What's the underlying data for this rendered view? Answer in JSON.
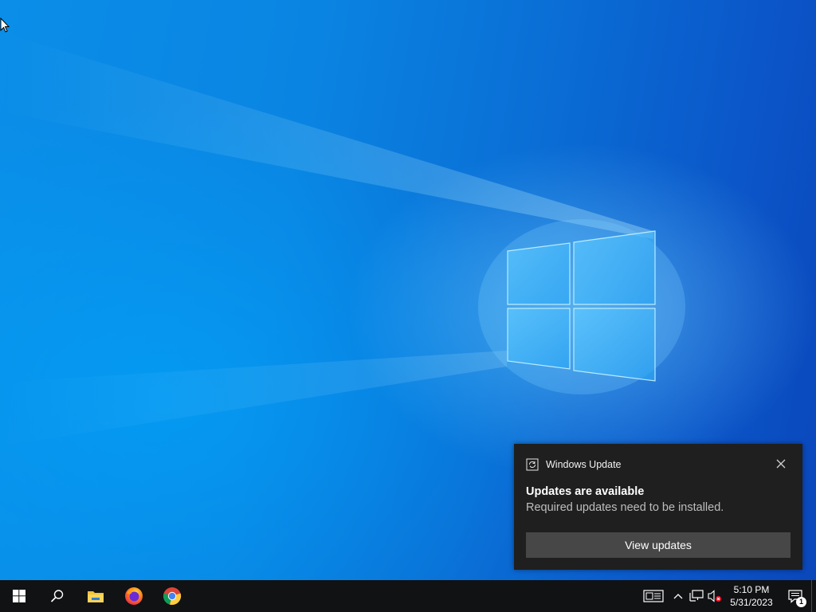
{
  "notification": {
    "app_name": "Windows Update",
    "title": "Updates are available",
    "body": "Required updates need to be installed.",
    "button_label": "View updates"
  },
  "taskbar": {
    "pinned": [
      {
        "name": "start-button",
        "icon": "windows-logo-icon"
      },
      {
        "name": "search-button",
        "icon": "search-icon"
      },
      {
        "name": "file-explorer",
        "icon": "folder-icon"
      },
      {
        "name": "firefox",
        "icon": "firefox-icon"
      },
      {
        "name": "chrome",
        "icon": "chrome-icon"
      }
    ],
    "tray": {
      "time": "5:10 PM",
      "date": "5/31/2023",
      "notification_count": "1",
      "icons": [
        "news-icon",
        "chevron-up-icon",
        "network-icon",
        "volume-muted-icon",
        "action-center-icon"
      ]
    }
  },
  "colors": {
    "taskbar_bg": "#101214",
    "toast_bg": "#1f1f1f",
    "toast_button_bg": "#474747",
    "wallpaper_blue": "#0a84e2"
  }
}
